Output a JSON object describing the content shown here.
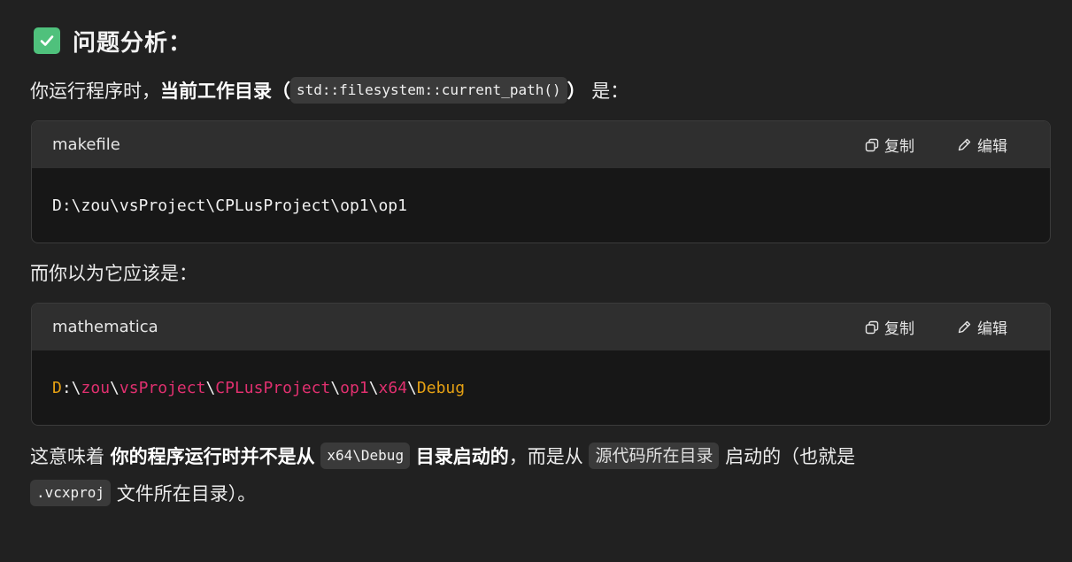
{
  "heading": {
    "icon": "check-mark-icon",
    "text": "问题分析："
  },
  "intro": {
    "prefix": "你运行程序时，",
    "bold": "当前工作目录（",
    "code": "std::filesystem::current_path()",
    "bold_close": "）",
    "suffix": " 是："
  },
  "block1": {
    "lang": "makefile",
    "copy_label": "复制",
    "edit_label": "编辑",
    "code": "D:\\zou\\vsProject\\CPLusProject\\op1\\op1"
  },
  "middle": {
    "text": "而你以为它应该是："
  },
  "block2": {
    "lang": "mathematica",
    "copy_label": "复制",
    "edit_label": "编辑",
    "tokens": [
      {
        "t": "D",
        "c": "a"
      },
      {
        "t": ":\\",
        "c": "p"
      },
      {
        "t": "zou",
        "c": "b"
      },
      {
        "t": "\\",
        "c": "p"
      },
      {
        "t": "vsProject",
        "c": "b"
      },
      {
        "t": "\\",
        "c": "p"
      },
      {
        "t": "CPLusProject",
        "c": "b"
      },
      {
        "t": "\\",
        "c": "p"
      },
      {
        "t": "op1",
        "c": "b"
      },
      {
        "t": "\\",
        "c": "p"
      },
      {
        "t": "x64",
        "c": "b"
      },
      {
        "t": "\\",
        "c": "p"
      },
      {
        "t": "Debug",
        "c": "a"
      }
    ]
  },
  "conclusion": {
    "line1_prefix": "这意味着 ",
    "line1_bold1": "你的程序运行时并不是从",
    "line1_code1": "x64\\Debug",
    "line1_bold2": "目录启动的",
    "line1_mid": "，而是从 ",
    "line1_code2": "源代码所在目录",
    "line1_suffix": " 启动的（也就是",
    "line2_code": ".vcxproj",
    "line2_suffix": " 文件所在目录）。"
  },
  "colors": {
    "background": "#212121",
    "code_header": "#2f2f2f",
    "code_body": "#171717",
    "check_green": "#4fc17c",
    "token_orange": "#e5a013",
    "token_pink": "#e0306f"
  }
}
